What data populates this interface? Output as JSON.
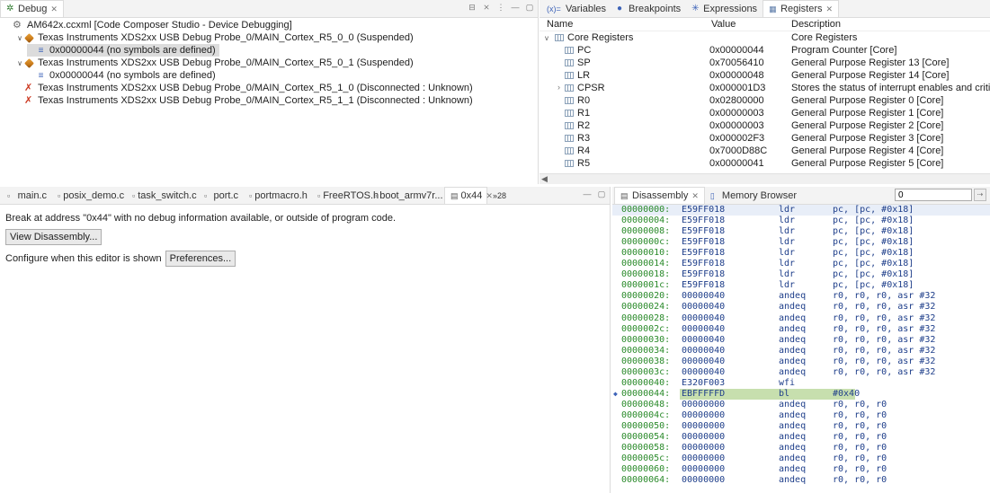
{
  "debug": {
    "tab_label": "Debug",
    "tree": [
      {
        "label": "AM642x.ccxml [Code Composer Studio - Device Debugging]",
        "indent": 0,
        "twisty": "",
        "icon": "gear"
      },
      {
        "label": "Texas Instruments XDS2xx USB Debug Probe_0/MAIN_Cortex_R5_0_0 (Suspended)",
        "indent": 1,
        "twisty": "v",
        "icon": "probe"
      },
      {
        "label": "0x00000044  (no symbols are defined)",
        "indent": 2,
        "twisty": "",
        "icon": "frame",
        "selected": true
      },
      {
        "label": "Texas Instruments XDS2xx USB Debug Probe_0/MAIN_Cortex_R5_0_1 (Suspended)",
        "indent": 1,
        "twisty": "v",
        "icon": "probe"
      },
      {
        "label": "0x00000044  (no symbols are defined)",
        "indent": 2,
        "twisty": "",
        "icon": "frame"
      },
      {
        "label": "Texas Instruments XDS2xx USB Debug Probe_0/MAIN_Cortex_R5_1_0 (Disconnected : Unknown)",
        "indent": 1,
        "twisty": "",
        "icon": "disc"
      },
      {
        "label": "Texas Instruments XDS2xx USB Debug Probe_0/MAIN_Cortex_R5_1_1 (Disconnected : Unknown)",
        "indent": 1,
        "twisty": "",
        "icon": "disc"
      }
    ]
  },
  "right_tabs": [
    "Variables",
    "Breakpoints",
    "Expressions",
    "Registers"
  ],
  "registers": {
    "headers": {
      "name": "Name",
      "value": "Value",
      "description": "Description"
    },
    "group": {
      "name": "Core Registers",
      "description": "Core Registers"
    },
    "rows": [
      {
        "name": "PC",
        "value": "0x00000044",
        "description": "Program Counter [Core]"
      },
      {
        "name": "SP",
        "value": "0x70056410",
        "description": "General Purpose Register 13 [Core]"
      },
      {
        "name": "LR",
        "value": "0x00000048",
        "description": "General Purpose Register 14 [Core]"
      },
      {
        "name": "CPSR",
        "value": "0x000001D3",
        "description": "Stores the status of interrupt enables and critical proces"
      },
      {
        "name": "R0",
        "value": "0x02800000",
        "description": "General Purpose Register 0 [Core]"
      },
      {
        "name": "R1",
        "value": "0x00000003",
        "description": "General Purpose Register 1 [Core]"
      },
      {
        "name": "R2",
        "value": "0x00000003",
        "description": "General Purpose Register 2 [Core]"
      },
      {
        "name": "R3",
        "value": "0x000002F3",
        "description": "General Purpose Register 3 [Core]"
      },
      {
        "name": "R4",
        "value": "0x7000D88C",
        "description": "General Purpose Register 4 [Core]"
      },
      {
        "name": "R5",
        "value": "0x00000041",
        "description": "General Purpose Register 5 [Core]"
      }
    ]
  },
  "editor": {
    "tabs": [
      "main.c",
      "posix_demo.c",
      "task_switch.c",
      "port.c",
      "portmacro.h",
      "FreeRTOS.h",
      "boot_armv7r...",
      "0x44"
    ],
    "overflow": "»28",
    "message": "Break at address \"0x44\" with no debug information available, or outside of program code.",
    "view_disassembly": "View Disassembly...",
    "configure_label": "Configure when this editor is shown",
    "preferences": "Preferences..."
  },
  "disassembly": {
    "tabs": [
      "Disassembly",
      "Memory Browser"
    ],
    "address_value": "0",
    "rows": [
      {
        "addr": "00000000:",
        "op": "E59FF018",
        "mn": "ldr",
        "args": "pc, [pc, #0x18]"
      },
      {
        "addr": "00000004:",
        "op": "E59FF018",
        "mn": "ldr",
        "args": "pc, [pc, #0x18]"
      },
      {
        "addr": "00000008:",
        "op": "E59FF018",
        "mn": "ldr",
        "args": "pc, [pc, #0x18]"
      },
      {
        "addr": "0000000c:",
        "op": "E59FF018",
        "mn": "ldr",
        "args": "pc, [pc, #0x18]"
      },
      {
        "addr": "00000010:",
        "op": "E59FF018",
        "mn": "ldr",
        "args": "pc, [pc, #0x18]"
      },
      {
        "addr": "00000014:",
        "op": "E59FF018",
        "mn": "ldr",
        "args": "pc, [pc, #0x18]"
      },
      {
        "addr": "00000018:",
        "op": "E59FF018",
        "mn": "ldr",
        "args": "pc, [pc, #0x18]"
      },
      {
        "addr": "0000001c:",
        "op": "E59FF018",
        "mn": "ldr",
        "args": "pc, [pc, #0x18]"
      },
      {
        "addr": "00000020:",
        "op": "00000040",
        "mn": "andeq",
        "args": "r0, r0, r0, asr #32"
      },
      {
        "addr": "00000024:",
        "op": "00000040",
        "mn": "andeq",
        "args": "r0, r0, r0, asr #32"
      },
      {
        "addr": "00000028:",
        "op": "00000040",
        "mn": "andeq",
        "args": "r0, r0, r0, asr #32"
      },
      {
        "addr": "0000002c:",
        "op": "00000040",
        "mn": "andeq",
        "args": "r0, r0, r0, asr #32"
      },
      {
        "addr": "00000030:",
        "op": "00000040",
        "mn": "andeq",
        "args": "r0, r0, r0, asr #32"
      },
      {
        "addr": "00000034:",
        "op": "00000040",
        "mn": "andeq",
        "args": "r0, r0, r0, asr #32"
      },
      {
        "addr": "00000038:",
        "op": "00000040",
        "mn": "andeq",
        "args": "r0, r0, r0, asr #32"
      },
      {
        "addr": "0000003c:",
        "op": "00000040",
        "mn": "andeq",
        "args": "r0, r0, r0, asr #32"
      },
      {
        "addr": "00000040:",
        "op": "E320F003",
        "mn": "wfi",
        "args": ""
      },
      {
        "addr": "00000044:",
        "op": "EBFFFFFD",
        "mn": "bl",
        "args": "#0x40",
        "current": true
      },
      {
        "addr": "00000048:",
        "op": "00000000",
        "mn": "andeq",
        "args": "r0, r0, r0"
      },
      {
        "addr": "0000004c:",
        "op": "00000000",
        "mn": "andeq",
        "args": "r0, r0, r0"
      },
      {
        "addr": "00000050:",
        "op": "00000000",
        "mn": "andeq",
        "args": "r0, r0, r0"
      },
      {
        "addr": "00000054:",
        "op": "00000000",
        "mn": "andeq",
        "args": "r0, r0, r0"
      },
      {
        "addr": "00000058:",
        "op": "00000000",
        "mn": "andeq",
        "args": "r0, r0, r0"
      },
      {
        "addr": "0000005c:",
        "op": "00000000",
        "mn": "andeq",
        "args": "r0, r0, r0"
      },
      {
        "addr": "00000060:",
        "op": "00000000",
        "mn": "andeq",
        "args": "r0, r0, r0"
      },
      {
        "addr": "00000064:",
        "op": "00000000",
        "mn": "andeq",
        "args": "r0, r0, r0"
      }
    ]
  },
  "colors": {
    "address": "#2a8a2a",
    "code": "#1e3e8a",
    "current_highlight": "#c7dfae",
    "selection": "#dcdcdc"
  }
}
